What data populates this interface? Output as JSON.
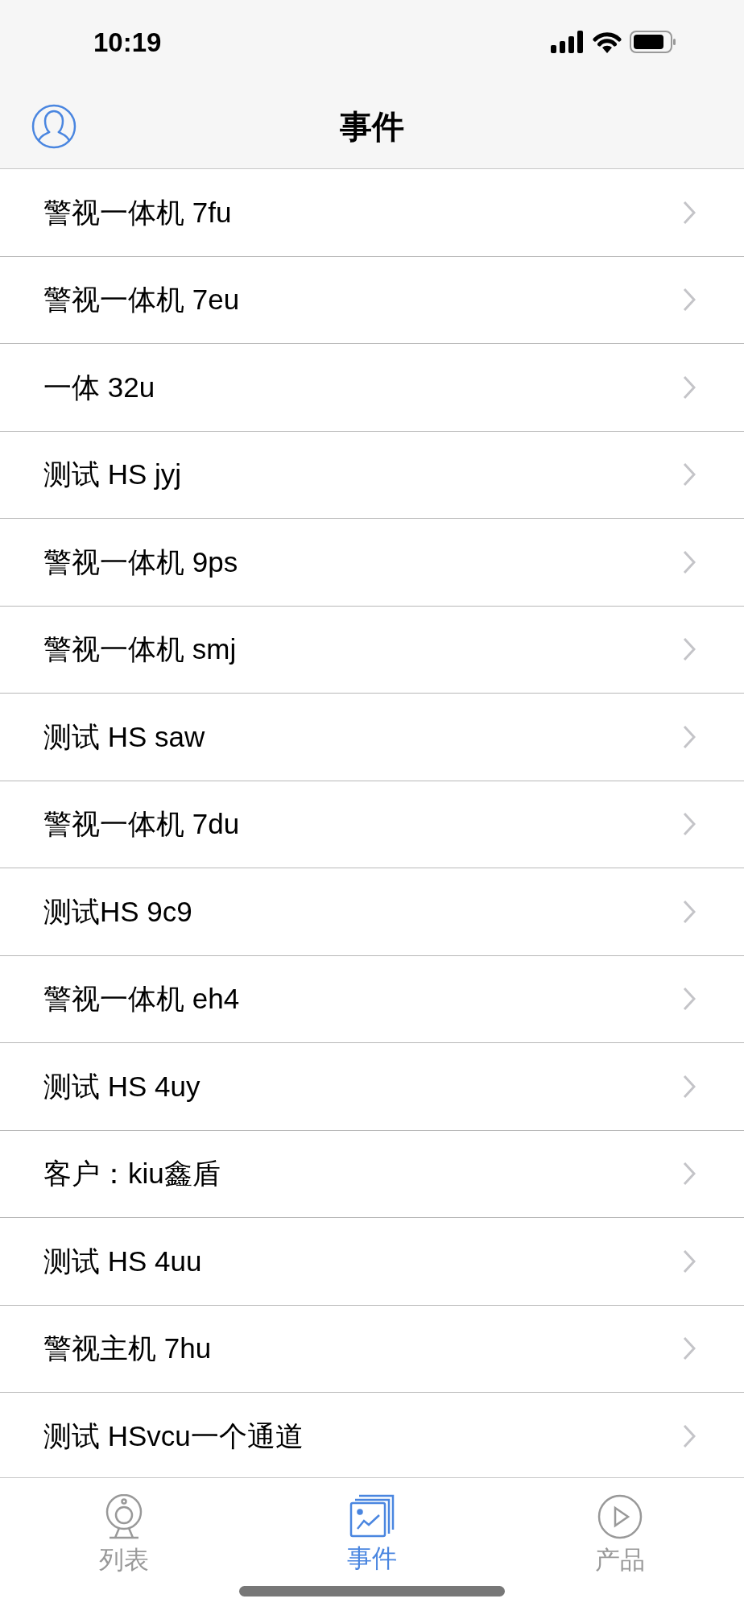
{
  "status_bar": {
    "time": "10:19"
  },
  "nav_bar": {
    "title": "事件"
  },
  "events": [
    {
      "name": "警视一体机 7fu"
    },
    {
      "name": "警视一体机 7eu"
    },
    {
      "name": "一体 32u"
    },
    {
      "name": "测试 HS jyj"
    },
    {
      "name": "警视一体机 9ps"
    },
    {
      "name": "警视一体机 smj"
    },
    {
      "name": "测试 HS saw"
    },
    {
      "name": "警视一体机 7du"
    },
    {
      "name": "测试HS 9c9"
    },
    {
      "name": "警视一体机 eh4"
    },
    {
      "name": "测试 HS 4uy"
    },
    {
      "name": "客户：kiu鑫盾"
    },
    {
      "name": "测试 HS 4uu"
    },
    {
      "name": "警视主机 7hu"
    },
    {
      "name": "测试 HSvcu一个通道"
    }
  ],
  "tab_bar": [
    {
      "label": "列表",
      "kind": "camera",
      "selected": false
    },
    {
      "label": "事件",
      "kind": "pictures",
      "selected": true
    },
    {
      "label": "产品",
      "kind": "play",
      "selected": false
    }
  ]
}
